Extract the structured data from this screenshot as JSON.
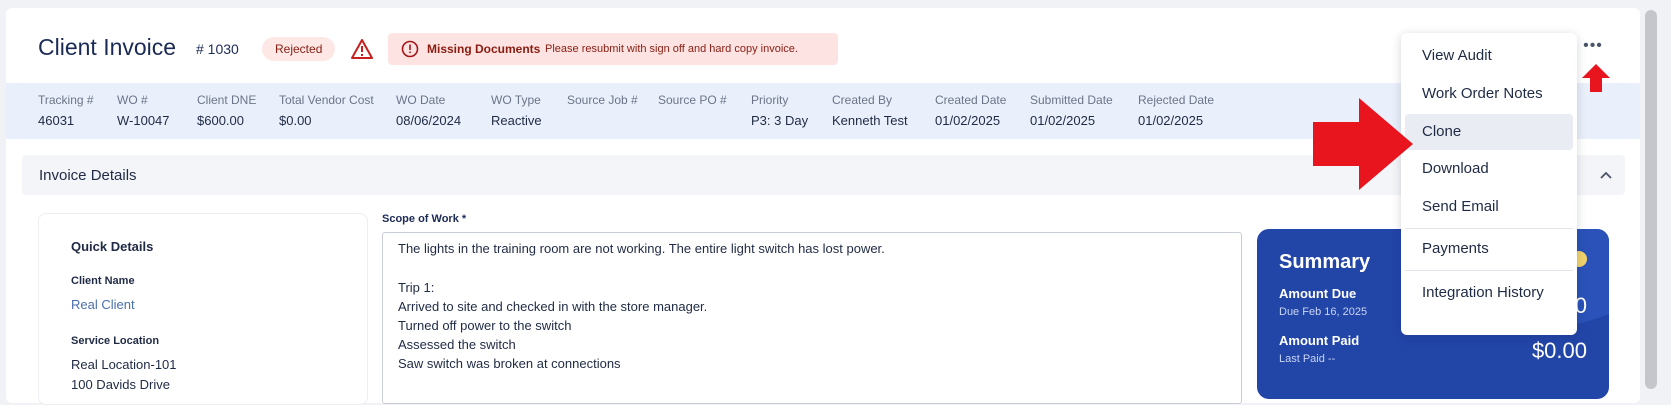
{
  "header": {
    "title": "Client Invoice",
    "invoice_number": "# 1030",
    "status_badge": "Rejected",
    "alert_title": "Missing Documents",
    "alert_message": "Please resubmit with sign off and hard copy invoice.",
    "more_icon": "ellipsis-icon"
  },
  "meta": [
    {
      "label": "Tracking #",
      "value": "46031"
    },
    {
      "label": "WO #",
      "value": "W-10047"
    },
    {
      "label": "Client DNE",
      "value": "$600.00"
    },
    {
      "label": "Total Vendor Cost",
      "value": "$0.00"
    },
    {
      "label": "WO Date",
      "value": "08/06/2024"
    },
    {
      "label": "WO Type",
      "value": "Reactive"
    },
    {
      "label": "Source Job #",
      "value": ""
    },
    {
      "label": "Source PO #",
      "value": ""
    },
    {
      "label": "Priority",
      "value": "P3: 3 Day"
    },
    {
      "label": "Created By",
      "value": "Kenneth Test"
    },
    {
      "label": "Created Date",
      "value": "01/02/2025"
    },
    {
      "label": "Submitted Date",
      "value": "01/02/2025"
    },
    {
      "label": "Rejected Date",
      "value": "01/02/2025"
    }
  ],
  "section": {
    "title": "Invoice Details"
  },
  "quick_details": {
    "heading": "Quick Details",
    "client_label": "Client Name",
    "client_value": "Real Client",
    "location_label": "Service Location",
    "location_line1": "Real Location-101",
    "location_line2": "100 Davids Drive"
  },
  "scope": {
    "label": "Scope of Work *",
    "lines": [
      "The lights in the training room are not working. The entire light switch has lost power.",
      "",
      "Trip 1:",
      "Arrived to site and checked in with the store manager.",
      "Turned off power to the switch",
      "Assessed the switch",
      "Saw switch was broken at connections"
    ]
  },
  "summary": {
    "title": "Summary",
    "amount_due_label": "Amount Due",
    "due_date": "Due Feb 16, 2025",
    "amount_due_value": "0",
    "amount_paid_label": "Amount Paid",
    "last_paid": "Last Paid --",
    "amount_paid_value": "$0.00"
  },
  "menu": {
    "items": [
      "View Audit",
      "Work Order Notes",
      "Clone",
      "Download",
      "Send Email",
      "Payments",
      "Integration History"
    ],
    "selected": "Clone"
  },
  "colors": {
    "accent": "#2245a8",
    "alert_bg": "#fde4e2",
    "alert_text": "#8a1c12",
    "annotation_red": "#e8141e"
  }
}
